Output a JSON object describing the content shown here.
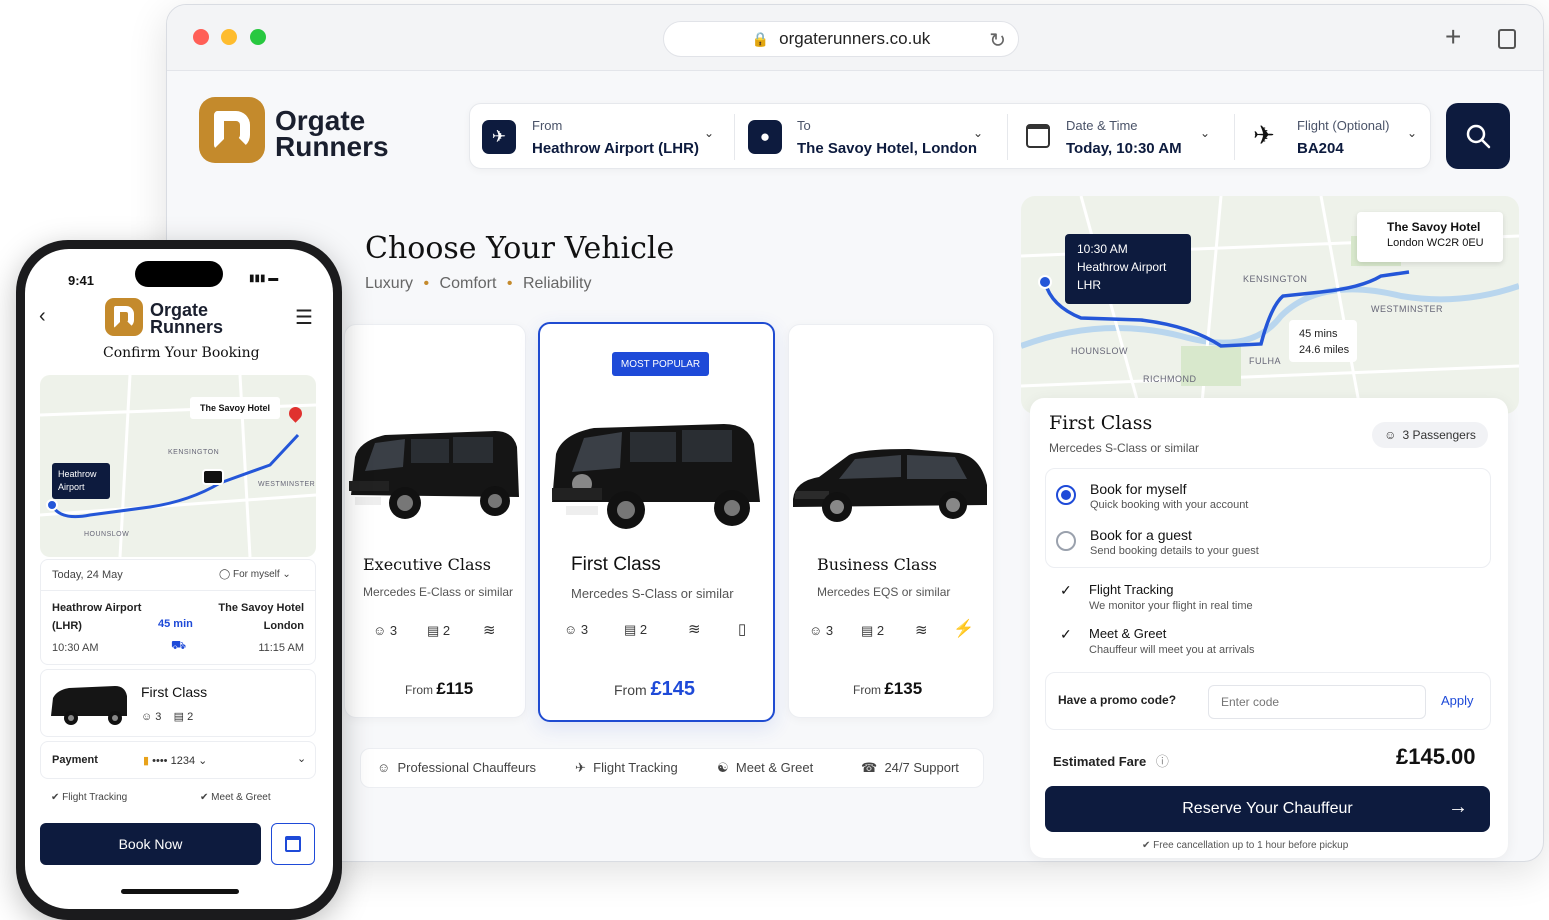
{
  "browser": {
    "url": "orgaterunners.co.uk",
    "logo": {
      "line1": "Orgate",
      "line2": "Runners"
    },
    "search": {
      "from_label": "From",
      "from_value": "Heathrow Airport (LHR)",
      "to_label": "To",
      "to_value": "The Savoy Hotel, London",
      "date_label": "Date & Time",
      "date_value": "Today, 10:30 AM",
      "flight_label": "Flight (Optional)",
      "flight_value": "BA204"
    }
  },
  "vehicles": {
    "title": "Choose Your Vehicle",
    "tagline": [
      "Luxury",
      "Comfort",
      "Reliability"
    ],
    "cards": [
      {
        "name": "Executive Class",
        "model": "Mercedes E-Class or similar",
        "pax": "3",
        "bags": "2",
        "price_prefix": "From",
        "price": "£115"
      },
      {
        "name": "First Class",
        "model": "Mercedes S-Class or similar",
        "pax": "3",
        "bags": "2",
        "price_prefix": "From",
        "price": "£145",
        "badge": "MOST POPULAR"
      },
      {
        "name": "Business Class",
        "model": "Mercedes EQS or similar",
        "pax": "3",
        "bags": "2",
        "price_prefix": "From",
        "price": "£135"
      }
    ],
    "features": [
      "Professional Chauffeurs",
      "Flight Tracking",
      "Meet & Greet",
      "24/7 Support"
    ]
  },
  "map": {
    "pickup": {
      "time": "10:30 AM",
      "place": "Heathrow Airport",
      "code": "LHR"
    },
    "dropoff": {
      "name": "The Savoy Hotel",
      "address": "London WC2R 0EU"
    },
    "eta": {
      "duration": "45 mins",
      "distance": "24.6 miles"
    },
    "areas": [
      "KENSINGTON",
      "WESTMINSTER",
      "HOUNSLOW",
      "RICHMOND",
      "FULHA"
    ]
  },
  "booking": {
    "class": "First Class",
    "model": "Mercedes S-Class or similar",
    "passengers": "3 Passengers",
    "options": [
      {
        "title": "Book for myself",
        "subtitle": "Quick booking with your account",
        "selected": true
      },
      {
        "title": "Book for a guest",
        "subtitle": "Send booking details to your guest",
        "selected": false
      }
    ],
    "services": [
      {
        "title": "Flight Tracking",
        "subtitle": "We monitor your flight in real time"
      },
      {
        "title": "Meet & Greet",
        "subtitle": "Chauffeur will meet you at arrivals"
      }
    ],
    "promo_label": "Have a promo code?",
    "promo_placeholder": "Enter code",
    "promo_apply": "Apply",
    "fare_label": "Estimated Fare",
    "fare": "£145.00",
    "cta": "Reserve Your Chauffeur",
    "footnote": "Free cancellation up to 1 hour before pickup"
  },
  "phone": {
    "time": "9:41",
    "logo": {
      "line1": "Orgate",
      "line2": "Runners"
    },
    "heading": "Confirm Your Booking",
    "map_dest": "The Savoy Hotel",
    "map_origin": "Heathrow Airport",
    "map_areas": [
      "KENSINGTON",
      "WESTMINSTER",
      "HOUNSLOW"
    ],
    "date": "Today, 24 May",
    "for_whom": "For myself",
    "from_place": "Heathrow Airport",
    "from_code": "(LHR)",
    "from_time": "10:30 AM",
    "duration": "45 min",
    "to_place": "The Savoy Hotel",
    "to_city": "London",
    "to_time": "11:15 AM",
    "vehicle": "First Class",
    "pax": "3",
    "bags": "2",
    "payment_label": "Payment",
    "card_masked": "•••• 1234",
    "services": [
      "Flight Tracking",
      "Meet & Greet"
    ],
    "cta": "Book Now"
  },
  "colors": {
    "navy": "#0d1b3e",
    "gold": "#c48a2c",
    "accent": "#1e4ad8",
    "route": "#2456d8",
    "pin": "#e0322f"
  }
}
